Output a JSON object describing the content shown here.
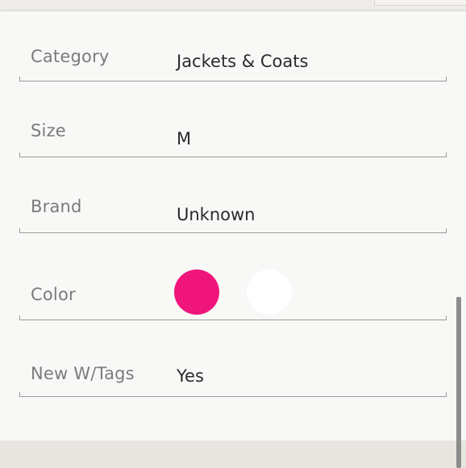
{
  "form": {
    "category": {
      "label": "Category",
      "value": "Jackets & Coats"
    },
    "size": {
      "label": "Size",
      "value": "M"
    },
    "brand": {
      "label": "Brand",
      "value": "Unknown"
    },
    "color": {
      "label": "Color",
      "swatches": [
        {
          "name": "pink",
          "hex": "#f0157a",
          "selected": true
        },
        {
          "name": "white",
          "hex": "#ffffff",
          "selected": false
        }
      ]
    },
    "new_with_tags": {
      "label": "New W/Tags",
      "value": "Yes"
    }
  }
}
